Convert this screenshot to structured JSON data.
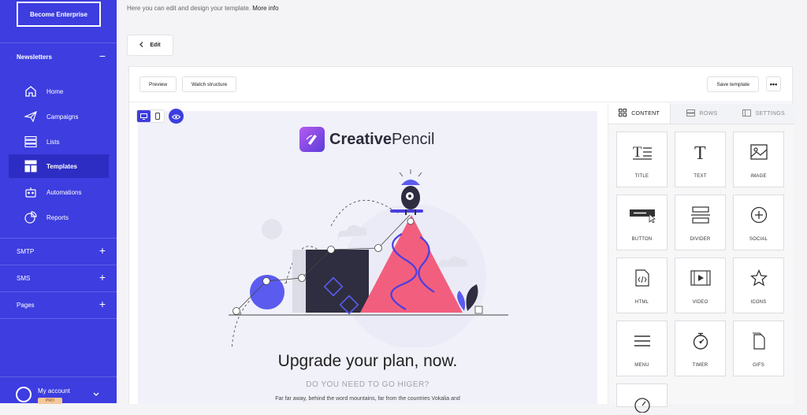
{
  "sidebar": {
    "enterprise_label": "Become Enterprise",
    "newsletters_label": "Newsletters",
    "items": [
      {
        "label": "Home",
        "icon": "home-icon"
      },
      {
        "label": "Campaigns",
        "icon": "paper-plane-icon"
      },
      {
        "label": "Lists",
        "icon": "list-icon"
      },
      {
        "label": "Templates",
        "icon": "templates-icon"
      },
      {
        "label": "Automations",
        "icon": "robot-icon"
      },
      {
        "label": "Reports",
        "icon": "pie-chart-icon"
      }
    ],
    "smtp_label": "SMTP",
    "sms_label": "SMS",
    "pages_label": "Pages",
    "account_label": "My account",
    "account_badge": "PRO"
  },
  "top": {
    "hint": "Here you can edit and design your template.",
    "more_info": "More info",
    "edit_label": "Edit"
  },
  "toolbar": {
    "preview_label": "Preview",
    "structure_label": "Watch structure",
    "save_label": "Save template",
    "more_label": "•••"
  },
  "email": {
    "brand_bold": "Creative",
    "brand_rest": "Pencil",
    "headline": "Upgrade your plan, now.",
    "subhead": "DO YOU NEED TO GO HIGER?",
    "body": "Far far away, behind the word mountains, far from the countries Vokalia and"
  },
  "panel": {
    "tabs": [
      {
        "label": "CONTENT",
        "icon": "grid-icon"
      },
      {
        "label": "ROWS",
        "icon": "rows-icon"
      },
      {
        "label": "SETTINGS",
        "icon": "settings-icon"
      }
    ],
    "blocks": [
      {
        "label": "TITLE",
        "icon": "title-icon"
      },
      {
        "label": "TEXT",
        "icon": "text-icon"
      },
      {
        "label": "IMAGE",
        "icon": "image-icon"
      },
      {
        "label": "BUTTON",
        "icon": "button-icon"
      },
      {
        "label": "DIVIDER",
        "icon": "divider-icon"
      },
      {
        "label": "SOCIAL",
        "icon": "social-icon"
      },
      {
        "label": "HTML",
        "icon": "html-icon"
      },
      {
        "label": "VIDEO",
        "icon": "video-icon"
      },
      {
        "label": "ICONS",
        "icon": "star-icon"
      },
      {
        "label": "MENU",
        "icon": "menu-icon"
      },
      {
        "label": "TIMER",
        "icon": "timer-icon"
      },
      {
        "label": "GIFS",
        "icon": "gif-icon"
      }
    ]
  },
  "colors": {
    "accent": "#3d3de0",
    "illustration_pink": "#f25f7e",
    "illustration_dark": "#2e2e40"
  }
}
